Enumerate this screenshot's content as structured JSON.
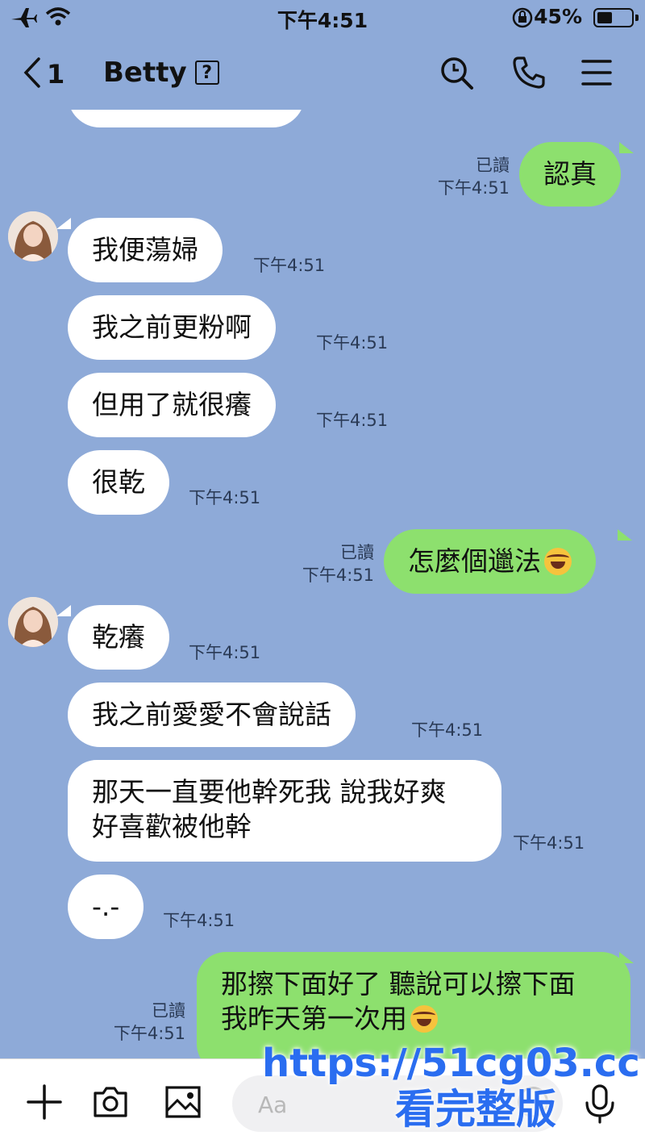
{
  "status": {
    "time": "下午4:51",
    "battery": "45%",
    "battery_level": 0.45
  },
  "header": {
    "back_count": "1",
    "title": "Betty",
    "title_badge": "?"
  },
  "icons": [
    "airplane-icon",
    "wifi-icon",
    "rotation-lock-icon",
    "battery-icon",
    "chevron-left-icon",
    "search-icon",
    "phone-icon",
    "menu-icon",
    "plus-icon",
    "camera-icon",
    "image-icon",
    "smiley-icon",
    "microphone-icon"
  ],
  "colors": {
    "background": "#8eaad8",
    "incoming_bubble": "#ffffff",
    "outgoing_bubble": "#8de06e"
  },
  "messages": [
    {
      "side": "out",
      "text": "認真",
      "read": "已讀",
      "time": "下午4:51"
    },
    {
      "side": "in",
      "text": "我便蕩婦",
      "time": "下午4:51"
    },
    {
      "side": "in",
      "text": "我之前更粉啊",
      "time": "下午4:51"
    },
    {
      "side": "in",
      "text": "但用了就很癢",
      "time": "下午4:51"
    },
    {
      "side": "in",
      "text": "很乾",
      "time": "下午4:51"
    },
    {
      "side": "out",
      "text": "怎麼個邋法",
      "read": "已讀",
      "time": "下午4:51",
      "emoji": "tears-of-joy"
    },
    {
      "side": "in",
      "text": "乾癢",
      "time": "下午4:51"
    },
    {
      "side": "in",
      "text": "我之前愛愛不會說話",
      "time": "下午4:51"
    },
    {
      "side": "in",
      "text": "那天一直要他幹死我 說我好爽 好喜歡被他幹",
      "time": "下午4:51"
    },
    {
      "side": "in",
      "text": "-.-",
      "time": "下午4:51"
    },
    {
      "side": "out",
      "text": "那擦下面好了 聽說可以擦下面 我昨天第一次用",
      "read": "已讀",
      "time": "下午4:51",
      "emoji": "tears-of-joy"
    }
  ],
  "composer": {
    "placeholder": "Aa"
  },
  "watermark": {
    "line1": "https://51cg03.cc",
    "line2": "看完整版"
  }
}
